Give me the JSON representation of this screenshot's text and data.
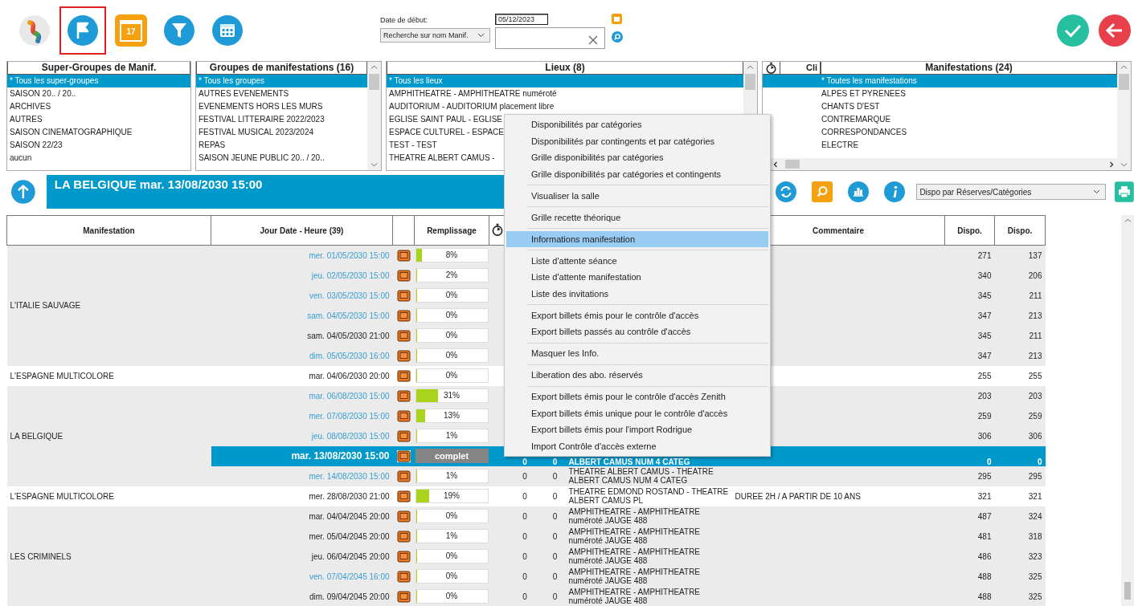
{
  "toolbar": [
    {
      "selected": false
    },
    {
      "selected": true
    },
    {
      "selected": false,
      "badge": "17"
    },
    {
      "selected": false
    },
    {
      "selected": false
    }
  ],
  "date_filter": {
    "label": "Date de début:",
    "date": "05/12/2023",
    "search_mode": "Recherche sur nom Manif."
  },
  "lists": [
    {
      "title": "Super-Groupes de Manif.",
      "scroll": false,
      "items": [
        {
          "label": "* Tous les super-groupes",
          "selected": true
        },
        {
          "label": "SAISON 20.. / 20..",
          "selected": false
        },
        {
          "label": "ARCHIVES",
          "selected": false
        },
        {
          "label": "AUTRES",
          "selected": false
        },
        {
          "label": "SAISON CINEMATOGRAPHIQUE",
          "selected": false
        },
        {
          "label": "SAISON 22/23",
          "selected": false
        },
        {
          "label": "aucun",
          "selected": false
        }
      ]
    },
    {
      "title": "Groupes de manifestations (16)",
      "scroll": true,
      "items": [
        {
          "label": "* Tous les groupes",
          "selected": true
        },
        {
          "label": "AUTRES EVENEMENTS",
          "selected": false
        },
        {
          "label": "EVENEMENTS HORS LES MURS",
          "selected": false
        },
        {
          "label": "FESTIVAL LITTERAIRE 2022/2023",
          "selected": false
        },
        {
          "label": "FESTIVAL MUSICAL 2023/2024",
          "selected": false
        },
        {
          "label": "REPAS",
          "selected": false
        },
        {
          "label": "SAISON JEUNE PUBLIC 20.. / 20..",
          "selected": false
        }
      ]
    },
    {
      "title": "Lieux (8)",
      "scroll": true,
      "items": [
        {
          "label": "* Tous les lieux",
          "selected": true
        },
        {
          "label": "AMPHITHEATRE - AMPHITHEATRE numéroté",
          "selected": false
        },
        {
          "label": "AUDITORIUM - AUDITORIUM placement libre",
          "selected": false
        },
        {
          "label": "EGLISE SAINT PAUL - EGLISE",
          "selected": false
        },
        {
          "label": "ESPACE CULTUREL - ESPACE",
          "selected": false
        },
        {
          "label": "TEST - TEST",
          "selected": false
        },
        {
          "label": "THEATRE ALBERT CAMUS -",
          "selected": false
        }
      ]
    },
    {
      "title": "Manifestations (24)",
      "scroll": true,
      "column_label": "Cli",
      "items": [
        {
          "label": "* Toutes les manifestations",
          "selected": true
        },
        {
          "label": "ALPES ET PYRENEES",
          "selected": false
        },
        {
          "label": "CHANTS D'EST",
          "selected": false
        },
        {
          "label": "CONTREMARQUE",
          "selected": false
        },
        {
          "label": "CORRESPONDANCES",
          "selected": false
        },
        {
          "label": "ELECTRE",
          "selected": false
        }
      ]
    }
  ],
  "title_bar": "LA BELGIQUE mar. 13/08/2030 15:00",
  "view_dropdown": "Dispo par Réserves/Catégories",
  "table": {
    "columns": {
      "event": "Manifestation",
      "date": "Jour Date - Heure (39)",
      "fill": "Remplissage",
      "comment": "Commentaire",
      "avail_1": "Dispo.",
      "avail_2": "Dispo."
    },
    "groups": [
      {
        "name": "L'ITALIE SAUVAGE",
        "sessions": [
          {
            "date": "mer. 01/05/2030 15:00",
            "accent": true,
            "selected": false,
            "full": false,
            "level": 0.08,
            "fill_text": "8%",
            "avail_1": "271",
            "avail_2": "137"
          },
          {
            "date": "jeu. 02/05/2030 15:00",
            "accent": true,
            "selected": false,
            "full": false,
            "level": 0.02,
            "fill_text": "2%",
            "avail_1": "340",
            "avail_2": "206"
          },
          {
            "date": "ven. 03/05/2030 15:00",
            "accent": true,
            "selected": false,
            "full": false,
            "level": 0,
            "fill_text": "0%",
            "avail_1": "345",
            "avail_2": "211"
          },
          {
            "date": "sam. 04/05/2030 15:00",
            "accent": true,
            "selected": false,
            "full": false,
            "level": 0,
            "fill_text": "0%",
            "avail_1": "347",
            "avail_2": "213"
          },
          {
            "date": "sam. 04/05/2030 21:00",
            "accent": false,
            "selected": false,
            "full": false,
            "level": 0,
            "fill_text": "0%",
            "avail_1": "345",
            "avail_2": "211"
          },
          {
            "date": "dim. 05/05/2030 16:00",
            "accent": true,
            "selected": false,
            "full": false,
            "level": 0,
            "fill_text": "0%",
            "avail_1": "347",
            "avail_2": "213"
          }
        ]
      },
      {
        "name": "L'ESPAGNE MULTICOLORE",
        "sessions": [
          {
            "date": "mar. 04/06/2030 20:00",
            "accent": false,
            "selected": false,
            "full": false,
            "level": 0,
            "fill_text": "0%",
            "avail_1": "255",
            "avail_2": "255"
          }
        ]
      },
      {
        "name": "LA BELGIQUE",
        "sessions": [
          {
            "date": "mar. 06/08/2030 15:00",
            "accent": true,
            "selected": false,
            "full": false,
            "level": 0.31,
            "fill_text": "31%",
            "avail_1": "203",
            "avail_2": "203"
          },
          {
            "date": "mer. 07/08/2030 15:00",
            "accent": true,
            "selected": false,
            "full": false,
            "level": 0.13,
            "fill_text": "13%",
            "avail_1": "259",
            "avail_2": "259"
          },
          {
            "date": "jeu. 08/08/2030 15:00",
            "accent": true,
            "selected": false,
            "full": false,
            "level": 0.01,
            "fill_text": "1%",
            "avail_1": "306",
            "avail_2": "306"
          },
          {
            "date": "mar. 13/08/2030 15:00",
            "accent": false,
            "selected": true,
            "full": true,
            "fill_text": "complet",
            "count_1": "0",
            "count_2": "0",
            "venue": "ALBERT CAMUS NUM 4 CATEG",
            "avail_1": "0",
            "avail_2": "0"
          },
          {
            "date": "mer. 14/08/2030 15:00",
            "accent": true,
            "selected": false,
            "full": false,
            "level": 0.01,
            "fill_text": "1%",
            "count_1": "0",
            "count_2": "0",
            "venue": "THEATRE ALBERT CAMUS - THEATRE ALBERT CAMUS NUM 4 CATEG",
            "avail_1": "295",
            "avail_2": "295"
          }
        ]
      },
      {
        "name": "L'ESPAGNE MULTICOLORE",
        "sessions": [
          {
            "date": "mer. 28/08/2030 21:00",
            "accent": false,
            "selected": false,
            "full": false,
            "level": 0.19,
            "fill_text": "19%",
            "count_1": "0",
            "count_2": "0",
            "venue": "THEATRE EDMOND ROSTAND - THEATRE ALBERT CAMUS PL",
            "comment": "DUREE 2H / A PARTIR DE 10 ANS",
            "avail_1": "321",
            "avail_2": "321"
          }
        ]
      },
      {
        "name": "LES CRIMINELS",
        "sessions": [
          {
            "date": "mar. 04/04/2045 20:00",
            "accent": false,
            "selected": false,
            "full": false,
            "level": 0,
            "fill_text": "0%",
            "count_1": "0",
            "count_2": "0",
            "venue": "AMPHITHEATRE - AMPHITHEATRE numéroté JAUGE 488",
            "avail_1": "487",
            "avail_2": "324"
          },
          {
            "date": "mer. 05/04/2045 20:00",
            "accent": false,
            "selected": false,
            "full": false,
            "level": 0.01,
            "fill_text": "1%",
            "count_1": "0",
            "count_2": "0",
            "venue": "AMPHITHEATRE - AMPHITHEATRE numéroté JAUGE 488",
            "avail_1": "481",
            "avail_2": "318"
          },
          {
            "date": "jeu. 06/04/2045 20:00",
            "accent": false,
            "selected": false,
            "full": false,
            "level": 0,
            "fill_text": "0%",
            "count_1": "0",
            "count_2": "0",
            "venue": "AMPHITHEATRE - AMPHITHEATRE numéroté JAUGE 488",
            "avail_1": "486",
            "avail_2": "323"
          },
          {
            "date": "ven. 07/04/2045 16:00",
            "accent": true,
            "selected": false,
            "full": false,
            "level": 0,
            "fill_text": "0%",
            "count_1": "0",
            "count_2": "0",
            "venue": "AMPHITHEATRE - AMPHITHEATRE numéroté JAUGE 488",
            "avail_1": "488",
            "avail_2": "325"
          },
          {
            "date": "dim. 09/04/2045 20:00",
            "accent": false,
            "selected": false,
            "full": false,
            "level": 0,
            "fill_text": "0%",
            "count_1": "0",
            "count_2": "0",
            "venue": "AMPHITHEATRE - AMPHITHEATRE numéroté JAUGE 488",
            "avail_1": "488",
            "avail_2": "325"
          }
        ]
      }
    ]
  },
  "context_menu": {
    "sections": [
      [
        {
          "label": "Disponibilités par catégories",
          "selected": false
        },
        {
          "label": "Disponibilités par contingents et par catégories",
          "selected": false
        },
        {
          "label": "Grille disponibilités par catégories",
          "selected": false
        },
        {
          "label": "Grille disponibilités par catégories et contingents",
          "selected": false
        }
      ],
      [
        {
          "label": "Visualiser la salle",
          "selected": false
        }
      ],
      [
        {
          "label": "Grille recette théorique",
          "selected": false
        }
      ],
      [
        {
          "label": "Informations manifestation",
          "selected": true
        }
      ],
      [
        {
          "label": "Liste d'attente séance",
          "selected": false
        },
        {
          "label": "Liste d'attente manifestation",
          "selected": false
        },
        {
          "label": "Liste des invitations",
          "selected": false
        }
      ],
      [
        {
          "label": "Export billets émis pour le contrôle d'accès",
          "selected": false
        },
        {
          "label": "Export billets passés au contrôle d'accès",
          "selected": false
        }
      ],
      [
        {
          "label": "Masquer les Info.",
          "selected": false
        }
      ],
      [
        {
          "label": "Liberation des abo. réservés",
          "selected": false
        }
      ],
      [
        {
          "label": "Export billets émis pour le contrôle d'accès Zenith",
          "selected": false
        },
        {
          "label": "Export billets émis unique pour le contrôle d'accès",
          "selected": false
        },
        {
          "label": "Export billets émis pour l'import Rodrigue",
          "selected": false
        },
        {
          "label": "Import Contrôle d'accès externe",
          "selected": false
        }
      ]
    ]
  }
}
